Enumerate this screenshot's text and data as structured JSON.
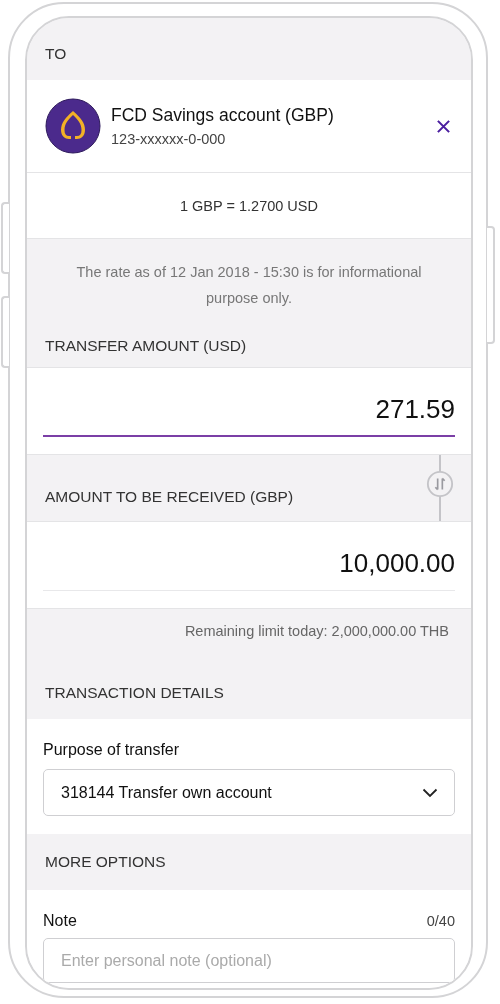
{
  "to_label": "TO",
  "recipient": {
    "name": "FCD Savings account (GBP)",
    "account": "123-xxxxxx-0-000"
  },
  "rate": "1 GBP = 1.2700 USD",
  "rate_note": "The rate as of 12 Jan 2018 - 15:30 is for informational purpose only.",
  "transfer_amount": {
    "label": "TRANSFER AMOUNT (USD)",
    "value": "271.59",
    "focused": true
  },
  "received_amount": {
    "label": "AMOUNT TO BE RECEIVED (GBP)",
    "value": "10,000.00",
    "focused": false
  },
  "remaining_limit": "Remaining limit today: 2,000,000.00 THB",
  "transaction_details": {
    "title": "TRANSACTION DETAILS",
    "purpose_label": "Purpose of transfer",
    "purpose_value": "318144 Transfer own account"
  },
  "more_options": {
    "title": "MORE OPTIONS",
    "note_label": "Note",
    "note_count": "0/40",
    "note_placeholder": "Enter personal note (optional)"
  }
}
